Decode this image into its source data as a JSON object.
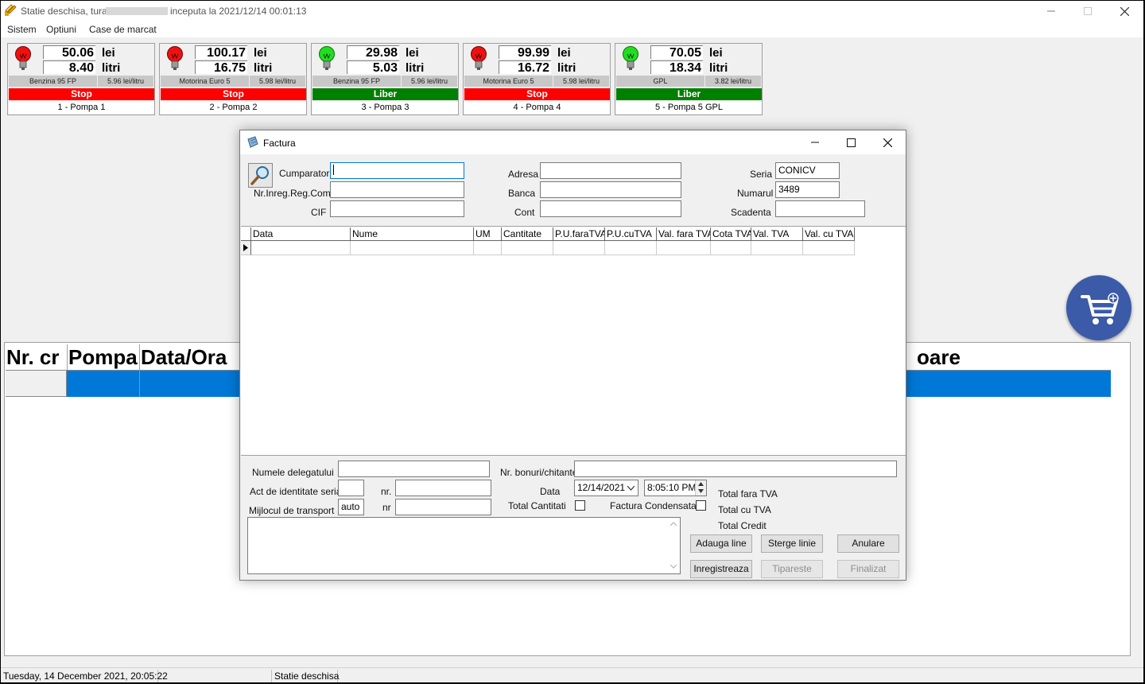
{
  "window": {
    "title_prefix": "Statie deschisa, tura",
    "title_suffix": "inceputa la 2021/12/14 00:01:13"
  },
  "menu": [
    "Sistem",
    "Optiuni",
    "Case de marcat"
  ],
  "pumps": [
    {
      "amount": "50.06",
      "amount_unit": "lei",
      "volume": "8.40",
      "volume_unit": "litri",
      "fuel": "Benzina 95 FP",
      "price": "5.96 lei/litru",
      "state": "Stop",
      "state_color": "#ff0000",
      "name": "1 - Pompa 1",
      "bulb": "red"
    },
    {
      "amount": "100.17",
      "amount_unit": "lei",
      "volume": "16.75",
      "volume_unit": "litri",
      "fuel": "Motorina Euro 5",
      "price": "5.98 lei/litru",
      "state": "Stop",
      "state_color": "#ff0000",
      "name": "2 - Pompa 2",
      "bulb": "red"
    },
    {
      "amount": "29.98",
      "amount_unit": "lei",
      "volume": "5.03",
      "volume_unit": "litri",
      "fuel": "Benzina 95 FP",
      "price": "5.96 lei/litru",
      "state": "Liber",
      "state_color": "#008000",
      "name": "3 - Pompa 3",
      "bulb": "green"
    },
    {
      "amount": "99.99",
      "amount_unit": "lei",
      "volume": "16.72",
      "volume_unit": "litri",
      "fuel": "Motorina Euro 5",
      "price": "5.98 lei/litru",
      "state": "Stop",
      "state_color": "#ff0000",
      "name": "4 - Pompa 4",
      "bulb": "red"
    },
    {
      "amount": "70.05",
      "amount_unit": "lei",
      "volume": "18.34",
      "volume_unit": "litri",
      "fuel": "GPL",
      "price": "3.82 lei/litru",
      "state": "Liber",
      "state_color": "#008000",
      "name": "5 - Pompa 5 GPL",
      "bulb": "green"
    }
  ],
  "main_table": {
    "headers": [
      "Nr. cr",
      "Pompa",
      "Data/Ora",
      "oare"
    ]
  },
  "statusbar": {
    "datetime": "Tuesday, 14 December 2021, 20:05:22",
    "status": "Statie deschisa"
  },
  "dialog": {
    "title": "Factura",
    "labels": {
      "cumparator": "Cumparator",
      "nr_inreg": "Nr.Inreg.Reg.Com.",
      "cif": "CIF",
      "adresa": "Adresa",
      "banca": "Banca",
      "cont": "Cont",
      "seria": "Seria",
      "numarul": "Numarul",
      "scadenta": "Scadenta",
      "delegat": "Numele delegatului",
      "act_seria": "Act de identitate seria.",
      "nr1": "nr.",
      "transport": "Mijlocul de transport",
      "nr2": "nr",
      "bonuri": "Nr. bonuri/chitante",
      "data": "Data",
      "total_cantitati": "Total Cantitati",
      "factura_condensata": "Factura Condensata",
      "total_fara_tva": "Total fara TVA",
      "total_cu_tva": "Total cu TVA",
      "total_credit": "Total Credit"
    },
    "values": {
      "seria": "CONICV",
      "numarul": "3489",
      "transport": "auto",
      "date": "12/14/2021",
      "time": "8:05:10 PM"
    },
    "grid_headers": [
      "Data",
      "Nume",
      "UM",
      "Cantitate",
      "P.U.faraTVA",
      "P.U.cuTVA",
      "Val. fara TVA",
      "Cota TVA",
      "Val. TVA",
      "Val. cu TVA"
    ],
    "buttons": {
      "adauga": "Adauga line",
      "sterge": "Sterge linie",
      "anulare": "Anulare",
      "inregistreaza": "Inregistreaza",
      "tipareste": "Tipareste",
      "finalizat": "Finalizat"
    }
  }
}
